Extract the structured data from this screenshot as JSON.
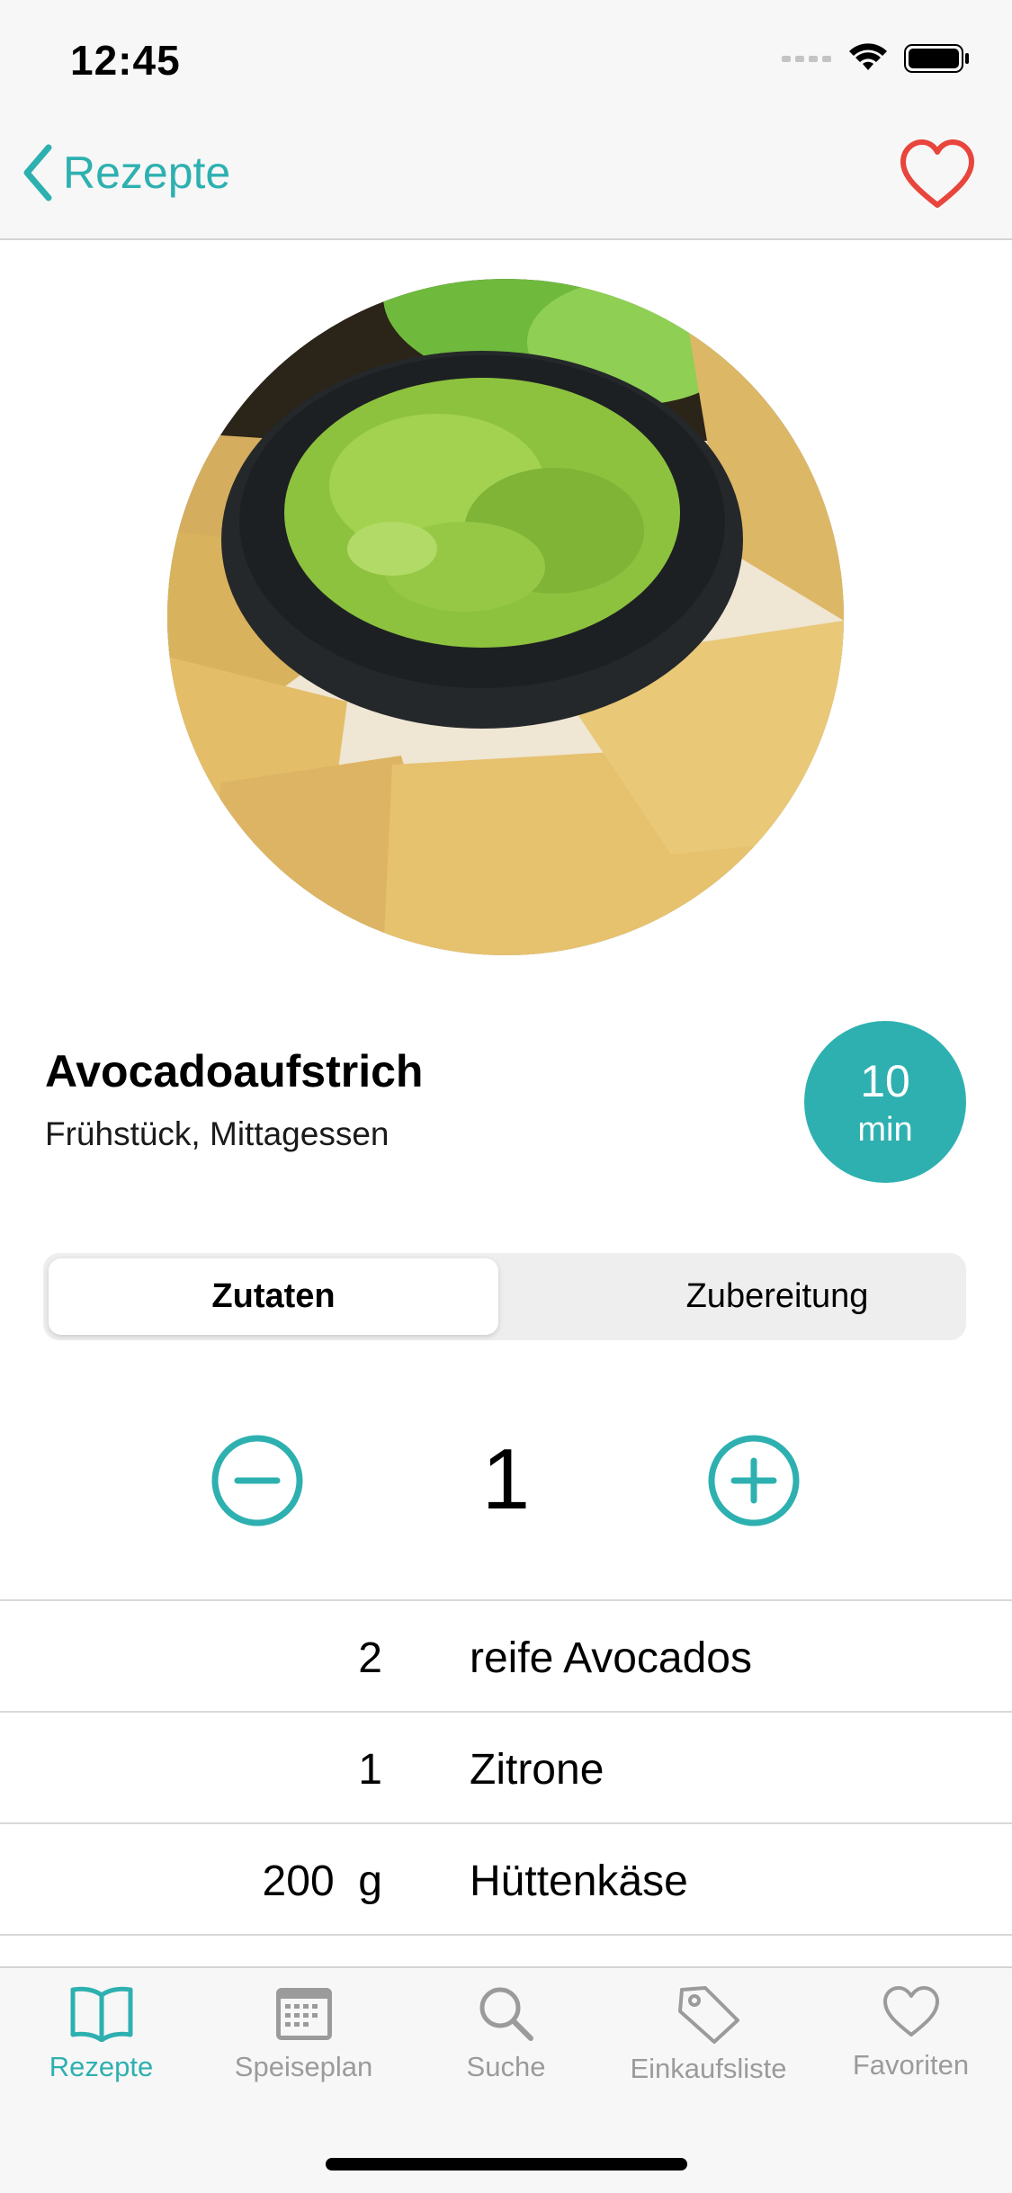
{
  "status_bar": {
    "time": "12:45"
  },
  "nav": {
    "back_label": "Rezepte"
  },
  "recipe": {
    "title": "Avocadoaufstrich",
    "categories": "Frühstück, Mittagessen",
    "time_value": "10",
    "time_unit": "min"
  },
  "segments": {
    "ingredients": "Zutaten",
    "preparation": "Zubereitung"
  },
  "servings": "1",
  "ingredients": [
    {
      "amount": "2",
      "name": "reife Avocados"
    },
    {
      "amount": "1",
      "name": "Zitrone"
    },
    {
      "amount": "200  g",
      "name": "Hüttenkäse"
    }
  ],
  "tabs": [
    {
      "label": "Rezepte",
      "icon": "book-icon"
    },
    {
      "label": "Speiseplan",
      "icon": "calendar-icon"
    },
    {
      "label": "Suche",
      "icon": "search-icon"
    },
    {
      "label": "Einkaufsliste",
      "icon": "tag-icon"
    },
    {
      "label": "Favoriten",
      "icon": "heart-icon"
    }
  ],
  "colors": {
    "accent": "#2eb0b0",
    "favorite": "#e8453c",
    "inactive": "#9b9b9b"
  }
}
